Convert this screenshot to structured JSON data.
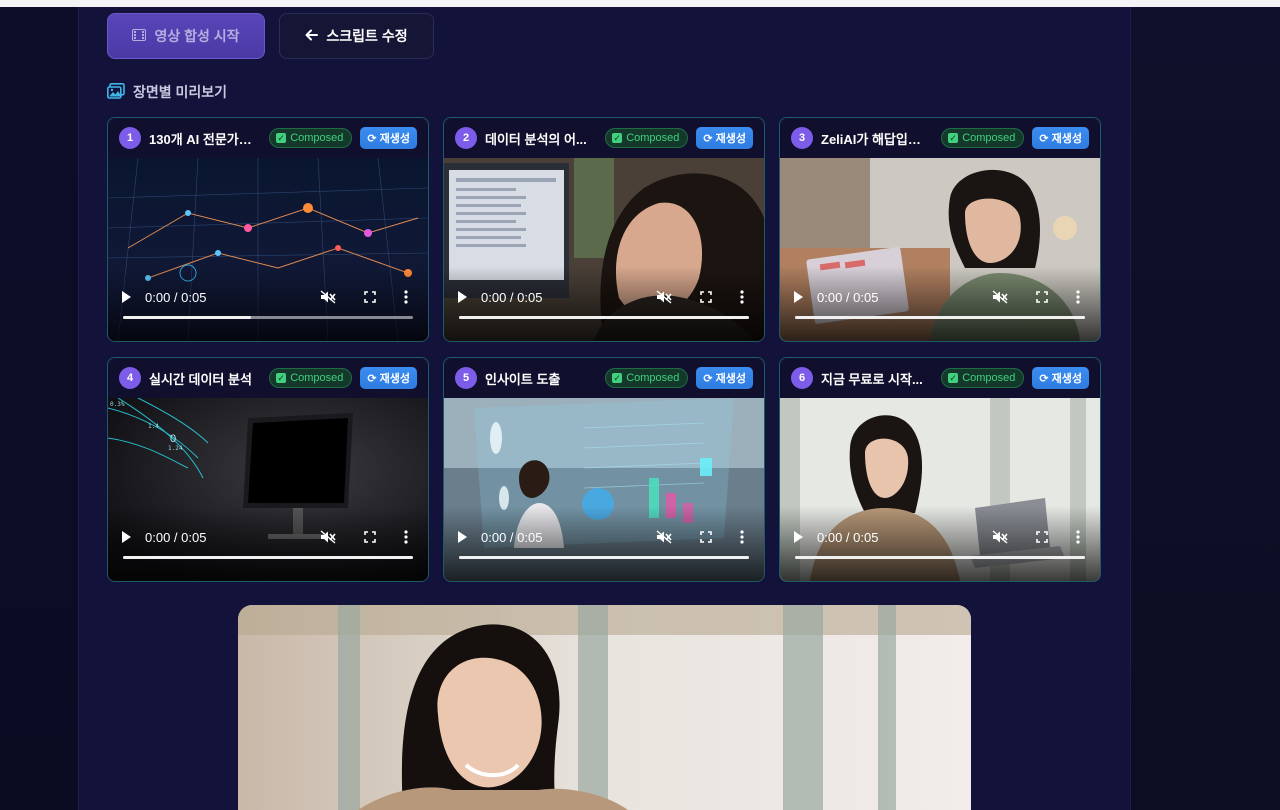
{
  "toolbar": {
    "compose_label": "영상 합성 시작",
    "edit_script_label": "스크립트 수정"
  },
  "section": {
    "title": "장면별 미리보기"
  },
  "scenes": [
    {
      "number": "1",
      "title": "130개 AI 전문가, ...",
      "status": "Composed",
      "regen_label": "재생성",
      "time": "0:00 / 0:05",
      "progress": 0.44
    },
    {
      "number": "2",
      "title": "데이터 분석의 어...",
      "status": "Composed",
      "regen_label": "재생성",
      "time": "0:00 / 0:05",
      "progress": 1.0
    },
    {
      "number": "3",
      "title": "ZeliAI가 해답입니다",
      "status": "Composed",
      "regen_label": "재생성",
      "time": "0:00 / 0:05",
      "progress": 1.0
    },
    {
      "number": "4",
      "title": "실시간 데이터 분석",
      "status": "Composed",
      "regen_label": "재생성",
      "time": "0:00 / 0:05",
      "progress": 1.0
    },
    {
      "number": "5",
      "title": "인사이트 도출",
      "status": "Composed",
      "regen_label": "재생성",
      "time": "0:00 / 0:05",
      "progress": 1.0
    },
    {
      "number": "6",
      "title": "지금 무료로 시작...",
      "status": "Composed",
      "regen_label": "재생성",
      "time": "0:00 / 0:05",
      "progress": 1.0
    }
  ],
  "icons": {
    "compose": "film-icon",
    "edit": "arrow-left-icon",
    "section": "images-icon",
    "status": "check-square-icon",
    "regen": "refresh-icon",
    "play": "play-icon",
    "mute": "volume-mute-icon",
    "fullscreen": "fullscreen-icon",
    "more": "more-vertical-icon"
  },
  "colors": {
    "accent_purple": "#7c5ce8",
    "composed_green": "#3fd17f",
    "regen_blue": "#3b8df0",
    "card_border": "#1f5a68"
  }
}
